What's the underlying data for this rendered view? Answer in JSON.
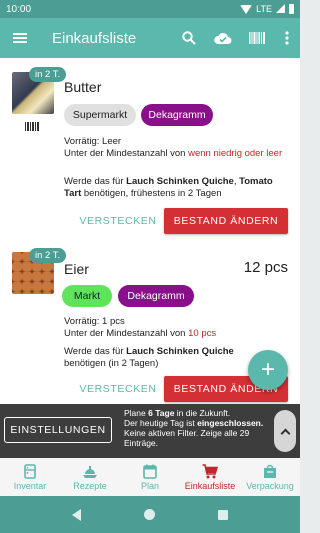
{
  "status_bar": {
    "time": "10:00",
    "network": "LTE"
  },
  "toolbar": {
    "title": "Einkaufsliste",
    "icons": [
      "menu-icon",
      "search-icon",
      "cloud-check-icon",
      "barcode-icon",
      "more-vert-icon"
    ]
  },
  "items": [
    {
      "due": "in 2 T.",
      "name": "Butter",
      "amount": "",
      "chips": [
        "Supermarkt",
        "Dekagramm"
      ],
      "stock_label": "Vorrätig:",
      "stock_value": "Leer",
      "min_prefix": "Unter der Mindestanzahl von",
      "min_value": "wenn niedrig oder leer",
      "needed_prefix": "Werde das für",
      "needed_recipes": "Lauch Schinken Quiche",
      "needed_sep": ",",
      "needed_recipes2": "Tomato Tart",
      "needed_suffix": "benötigen, frühestens in 2 Tagen",
      "hide_label": "VERSTECKEN",
      "change_label": "BESTAND ÄNDERN"
    },
    {
      "due": "in 2 T.",
      "name": "Eier",
      "amount": "12 pcs",
      "chips": [
        "Markt",
        "Dekagramm"
      ],
      "stock_label": "Vorrätig:",
      "stock_value": "1 pcs",
      "min_prefix": "Unter der Mindestanzahl von",
      "min_value": "10 pcs",
      "needed_prefix": "Werde das für",
      "needed_recipes": "Lauch Schinken Quiche",
      "needed_suffix": "benötigen (in 2 Tagen)",
      "hide_label": "VERSTECKEN",
      "change_label": "BESTAND ÄNDERN"
    }
  ],
  "fab": {
    "label": "+"
  },
  "filter": {
    "settings_label": "EINSTELLUNGEN",
    "line1_prefix": "Plane",
    "line1_bold": "6 Tage",
    "line1_suffix": "in die Zukunft.",
    "line2_prefix": "Der heutige Tag ist",
    "line2_bold": "eingeschlossen.",
    "line3": "Keine aktiven Filter. Zeige alle 29 Einträge."
  },
  "bottom_nav": [
    {
      "label": "Inventar",
      "icon": "fridge-icon"
    },
    {
      "label": "Rezepte",
      "icon": "recipes-icon"
    },
    {
      "label": "Plan",
      "icon": "calendar-icon"
    },
    {
      "label": "Einkaufsliste",
      "icon": "cart-icon",
      "active": true
    },
    {
      "label": "Verpackung",
      "icon": "package-icon"
    }
  ],
  "colors": {
    "primary": "#5bb8ad",
    "primary_dark": "#4c9e95",
    "accent_red": "#d32f35",
    "chip_purple": "#8a0f8a",
    "chip_green": "#5fe35a"
  }
}
